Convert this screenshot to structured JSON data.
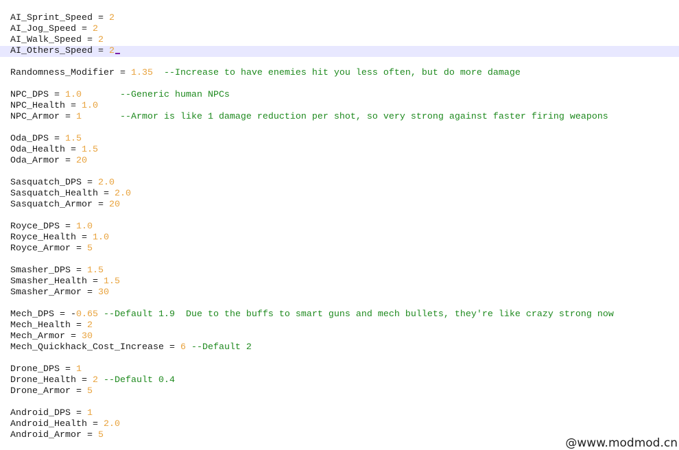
{
  "editor": {
    "current_line": 3,
    "colors": {
      "text": "#1a1a1a",
      "number": "#e8a23c",
      "comment": "#1f8a1f",
      "current_line_bg": "#e8e8ff",
      "cursor": "#7a1fa8"
    },
    "lines": [
      [
        [
          "k",
          "AI_Sprint_Speed = "
        ],
        [
          "n",
          "2"
        ]
      ],
      [
        [
          "k",
          "AI_Jog_Speed = "
        ],
        [
          "n",
          "2"
        ]
      ],
      [
        [
          "k",
          "AI_Walk_Speed = "
        ],
        [
          "n",
          "2"
        ]
      ],
      [
        [
          "k",
          "AI_Others_Speed = "
        ],
        [
          "n",
          "2"
        ]
      ],
      [],
      [
        [
          "k",
          "Randomness_Modifier = "
        ],
        [
          "n",
          "1.35"
        ],
        [
          "c",
          "  --Increase to have enemies hit you less often, but do more damage"
        ]
      ],
      [],
      [
        [
          "k",
          "NPC_DPS = "
        ],
        [
          "n",
          "1.0"
        ],
        [
          "c",
          "       --Generic human NPCs"
        ]
      ],
      [
        [
          "k",
          "NPC_Health = "
        ],
        [
          "n",
          "1.0"
        ]
      ],
      [
        [
          "k",
          "NPC_Armor = "
        ],
        [
          "n",
          "1"
        ],
        [
          "c",
          "       --Armor is like 1 damage reduction per shot, so very strong against faster firing weapons"
        ]
      ],
      [],
      [
        [
          "k",
          "Oda_DPS = "
        ],
        [
          "n",
          "1.5"
        ]
      ],
      [
        [
          "k",
          "Oda_Health = "
        ],
        [
          "n",
          "1.5"
        ]
      ],
      [
        [
          "k",
          "Oda_Armor = "
        ],
        [
          "n",
          "20"
        ]
      ],
      [],
      [
        [
          "k",
          "Sasquatch_DPS = "
        ],
        [
          "n",
          "2.0"
        ]
      ],
      [
        [
          "k",
          "Sasquatch_Health = "
        ],
        [
          "n",
          "2.0"
        ]
      ],
      [
        [
          "k",
          "Sasquatch_Armor = "
        ],
        [
          "n",
          "20"
        ]
      ],
      [],
      [
        [
          "k",
          "Royce_DPS = "
        ],
        [
          "n",
          "1.0"
        ]
      ],
      [
        [
          "k",
          "Royce_Health = "
        ],
        [
          "n",
          "1.0"
        ]
      ],
      [
        [
          "k",
          "Royce_Armor = "
        ],
        [
          "n",
          "5"
        ]
      ],
      [],
      [
        [
          "k",
          "Smasher_DPS = "
        ],
        [
          "n",
          "1.5"
        ]
      ],
      [
        [
          "k",
          "Smasher_Health = "
        ],
        [
          "n",
          "1.5"
        ]
      ],
      [
        [
          "k",
          "Smasher_Armor = "
        ],
        [
          "n",
          "30"
        ]
      ],
      [],
      [
        [
          "k",
          "Mech_DPS = -"
        ],
        [
          "n",
          "0.65"
        ],
        [
          "c",
          " --Default 1.9  Due to the buffs to smart guns and mech bullets, they're like crazy strong now"
        ]
      ],
      [
        [
          "k",
          "Mech_Health = "
        ],
        [
          "n",
          "2"
        ]
      ],
      [
        [
          "k",
          "Mech_Armor = "
        ],
        [
          "n",
          "30"
        ]
      ],
      [
        [
          "k",
          "Mech_Quickhack_Cost_Increase = "
        ],
        [
          "n",
          "6"
        ],
        [
          "c",
          " --Default 2"
        ]
      ],
      [],
      [
        [
          "k",
          "Drone_DPS = "
        ],
        [
          "n",
          "1"
        ]
      ],
      [
        [
          "k",
          "Drone_Health = "
        ],
        [
          "n",
          "2"
        ],
        [
          "c",
          " --Default 0.4"
        ]
      ],
      [
        [
          "k",
          "Drone_Armor = "
        ],
        [
          "n",
          "5"
        ]
      ],
      [],
      [
        [
          "k",
          "Android_DPS = "
        ],
        [
          "n",
          "1"
        ]
      ],
      [
        [
          "k",
          "Android_Health = "
        ],
        [
          "n",
          "2.0"
        ]
      ],
      [
        [
          "k",
          "Android_Armor = "
        ],
        [
          "n",
          "5"
        ]
      ]
    ]
  },
  "watermark": "@www.modmod.cn"
}
